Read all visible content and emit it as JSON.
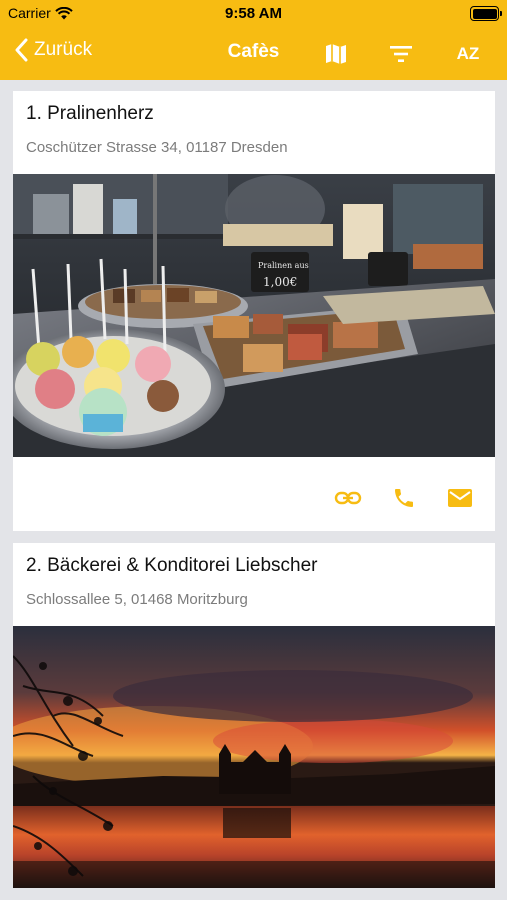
{
  "status": {
    "carrier": "Carrier",
    "time": "9:58 AM"
  },
  "nav": {
    "back_label": "Zurück",
    "title": "Cafès",
    "sort_label": "AZ"
  },
  "colors": {
    "accent": "#f7bc12",
    "background": "#e3e4e8"
  },
  "icons": {
    "map": "map-icon",
    "filter": "filter-icon",
    "link": "link-icon",
    "phone": "phone-icon",
    "mail": "mail-icon"
  },
  "cafes": [
    {
      "name": "1. Pralinenherz",
      "address": "Coschützer Strasse 34, 01187 Dresden"
    },
    {
      "name": "2. Bäckerei & Konditorei Liebscher",
      "address": "Schlossallee 5, 01468 Moritzburg"
    }
  ],
  "photo1": {
    "sign_line1": "Pralinen aus",
    "sign_line2": "1,00€"
  }
}
